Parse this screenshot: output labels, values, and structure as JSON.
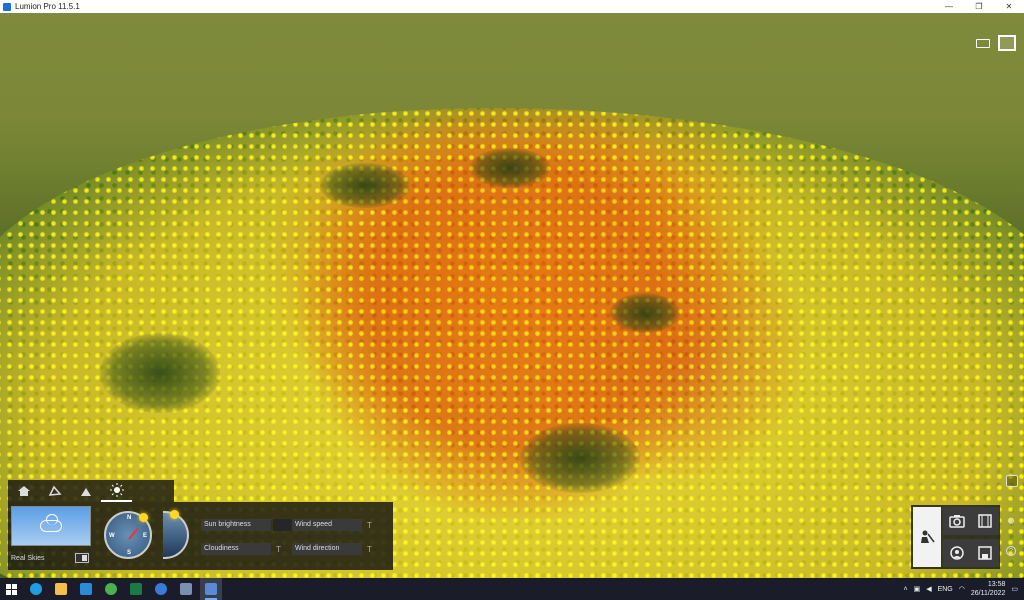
{
  "window": {
    "title": "Lumion Pro 11.5.1",
    "controls": {
      "minimize": "—",
      "restore": "❐",
      "close": "✕"
    }
  },
  "colors": {
    "accent": "#6ab0ff",
    "panel_bg": "#121212",
    "sky_top": "#5c9ee6",
    "sun": "#ffd72a"
  },
  "weather": {
    "tabs": [
      {
        "icon": "home-icon"
      },
      {
        "icon": "landscape-icon"
      },
      {
        "icon": "mountain-icon"
      },
      {
        "icon": "sun-icon",
        "active": true
      }
    ],
    "real_skies_label": "Real Skies",
    "compass": {
      "n": "N",
      "s": "S",
      "w": "W",
      "e": "E"
    },
    "sliders": [
      {
        "label": "Sun brightness"
      },
      {
        "label": "Wind speed"
      },
      {
        "label": "Cloudiness"
      },
      {
        "label": "Wind direction"
      }
    ],
    "t_marker": "T"
  },
  "modes": [
    {
      "icon": "build-mode-icon",
      "active": true
    },
    {
      "icon": "photo-mode-icon"
    },
    {
      "icon": "movie-mode-icon"
    },
    {
      "icon": "360-panorama-icon"
    },
    {
      "icon": "save-icon"
    }
  ],
  "side_icons": {
    "settings": "⚙",
    "help": "?"
  },
  "taskbar": {
    "apps": [
      "windows-start-icon",
      "search-icon",
      "edge-icon",
      "file-explorer-icon",
      "store-icon",
      "chrome-icon",
      "excel-icon",
      "app-icon",
      "security-icon",
      "lumion-icon"
    ],
    "language": "ENG",
    "time": "13:58",
    "date": "26/11/2022"
  }
}
